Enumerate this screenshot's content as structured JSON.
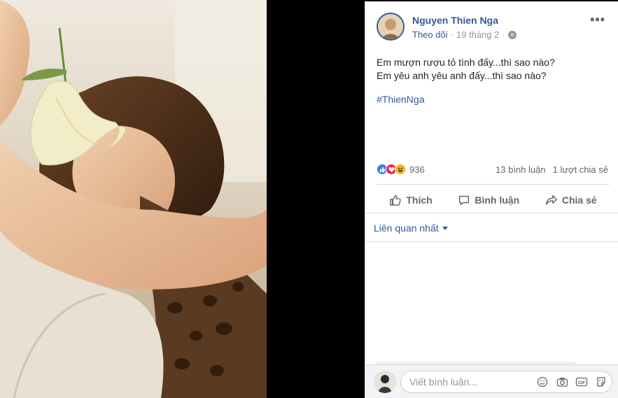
{
  "post": {
    "author": "Nguyen Thien Nga",
    "follow_label": "Theo dõi",
    "separator": "·",
    "date": "19 tháng 2",
    "separator2": "·",
    "more_label": "•••",
    "lines": [
      "Em mượn rượu tỏ tình đấy...thì sao nào?",
      "Em yêu anh yêu anh đấy...thì sao nào?"
    ],
    "hashtag": "#ThienNga"
  },
  "stats": {
    "reaction_count": "936",
    "comments": "13 bình luận",
    "shares": "1 lượt chia sẻ"
  },
  "actions": {
    "like": "Thích",
    "comment": "Bình luận",
    "share": "Chia sẻ"
  },
  "comments": {
    "sort_label": "Liên quan nhất",
    "placeholder": "Viết bình luận..."
  },
  "colors": {
    "link": "#365899",
    "like": "#3b82e8",
    "love": "#f0284a",
    "haha": "#f7b125"
  }
}
